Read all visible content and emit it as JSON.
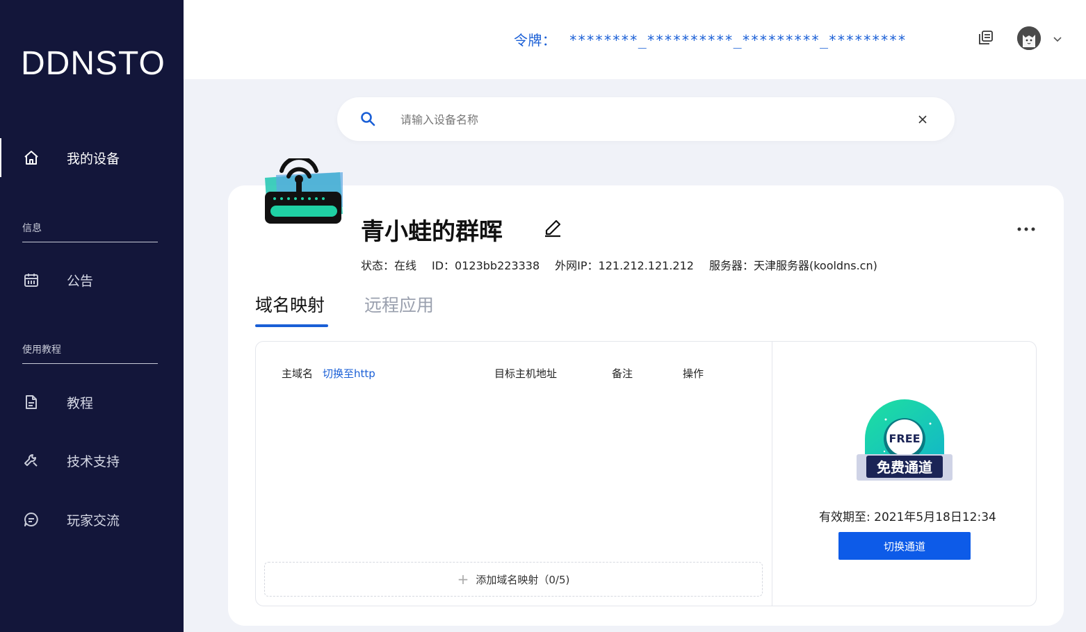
{
  "sidebar": {
    "logo": "DDNSTO",
    "items": [
      {
        "label": "我的设备",
        "icon": "home-icon"
      },
      {
        "label": "公告",
        "icon": "calendar-icon"
      },
      {
        "label": "教程",
        "icon": "document-icon"
      },
      {
        "label": "技术支持",
        "icon": "wrench-icon"
      },
      {
        "label": "玩家交流",
        "icon": "chat-icon"
      }
    ],
    "sections": [
      "信息",
      "使用教程"
    ]
  },
  "header": {
    "token_label": "令牌：",
    "token_value": "********_**********_*********_*********",
    "icons": [
      "copy-icon",
      "avatar",
      "chevron-down-icon"
    ]
  },
  "search": {
    "placeholder": "请输入设备名称",
    "value": ""
  },
  "device": {
    "name": "青小蛙的群晖",
    "status": "状态：在线",
    "id": "ID：0123bb223338",
    "ip": "外网IP：121.212.121.212",
    "server": "服务器：天津服务器(kooldns.cn)"
  },
  "tabs": [
    {
      "label": "域名映射",
      "active": true
    },
    {
      "label": "远程应用",
      "active": false
    }
  ],
  "table": {
    "col_host": "主域名",
    "switch_link": "切换至http",
    "col_target": "目标主机地址",
    "col_note": "备注",
    "col_action": "操作",
    "add_label": "添加域名映射（0/5)"
  },
  "channel": {
    "badge_top": "FREE",
    "badge_text": "免费通道",
    "valid_until": "有效期至: 2021年5月18日12:34",
    "switch_button": "切换通道"
  },
  "colors": {
    "sidebar_bg": "#13163a",
    "accent": "#1a5fd6",
    "button": "#0d5be8",
    "page_bg": "#f0f2f8"
  }
}
